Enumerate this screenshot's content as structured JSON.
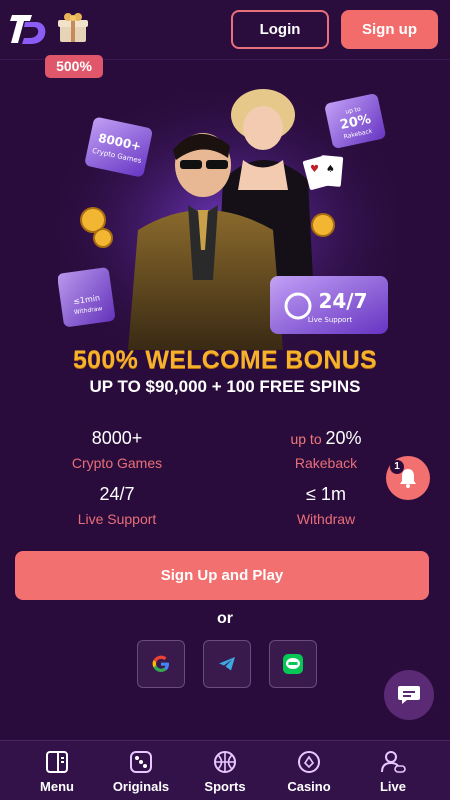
{
  "header": {
    "gift_badge": "500%",
    "login_label": "Login",
    "signup_label": "Sign up"
  },
  "hero": {
    "card_games_number": "8000+",
    "card_games_text": "Crypto Games",
    "card_rakeback_top": "up to",
    "card_rakeback_value": "20%",
    "card_rakeback_text": "Rakeback",
    "card_support_value": "24/7",
    "card_support_text": "Live Support",
    "card_withdraw_value": "≤1min",
    "card_withdraw_text": "Withdraw"
  },
  "bonus": {
    "title": "500% WELCOME BONUS",
    "subtitle": "UP TO $90,000 + 100 FREE SPINS"
  },
  "stats": [
    {
      "prefix": "",
      "value": "8000+",
      "label": "Crypto Games"
    },
    {
      "prefix": "up to ",
      "value": "20%",
      "label": "Rakeback"
    },
    {
      "prefix": "",
      "value": "24/7",
      "label": "Live Support"
    },
    {
      "prefix": "",
      "value": "≤ 1m",
      "label": "Withdraw"
    }
  ],
  "cta_label": "Sign Up and Play",
  "or_text": "or",
  "social": [
    "google-icon",
    "telegram-icon",
    "line-icon"
  ],
  "notification_count": "1",
  "nav": [
    {
      "label": "Menu",
      "icon": "menu-panel-icon"
    },
    {
      "label": "Originals",
      "icon": "dice-icon"
    },
    {
      "label": "Sports",
      "icon": "basketball-icon"
    },
    {
      "label": "Casino",
      "icon": "casino-chip-icon"
    },
    {
      "label": "Live",
      "icon": "live-dealer-icon"
    }
  ],
  "colors": {
    "background": "#2a0c3c",
    "accent": "#f37070",
    "gold": "#f7b22c",
    "label_pink": "#e86f78"
  }
}
